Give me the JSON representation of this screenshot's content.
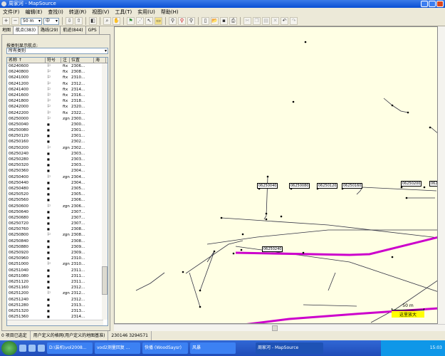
{
  "window": {
    "title": "周家河 - MapSource"
  },
  "menu": [
    "文件(F)",
    "编辑(E)",
    "查找(I)",
    "转送(R)",
    "视图(V)",
    "工具(T)",
    "实用(U)",
    "帮助(H)"
  ],
  "toolbar": {
    "zoom_scale": "50 m",
    "detail": "中"
  },
  "tabs": [
    "地图",
    "航点(383)",
    "路线(29)",
    "航迹(844)",
    "GPS"
  ],
  "waypoints_panel": {
    "category_label": "按类别显示航点:",
    "category_value": "所有类别",
    "columns": [
      "名称 ↑",
      "符号",
      "注",
      "位置",
      "海"
    ],
    "rows": [
      [
        "06240600",
        "flag",
        "ftx",
        "2306..."
      ],
      [
        "06240800",
        "flag",
        "ftx",
        "2308..."
      ],
      [
        "06241000",
        "flag",
        "ftx",
        "2310..."
      ],
      [
        "06241200",
        "flag",
        "ftx",
        "2312..."
      ],
      [
        "06241400",
        "flag",
        "ftx",
        "2314..."
      ],
      [
        "06241600",
        "flag",
        "ftx",
        "2316..."
      ],
      [
        "06241800",
        "flag",
        "ftx",
        "2318..."
      ],
      [
        "06242000",
        "flag",
        "ftx",
        "2320..."
      ],
      [
        "06242200",
        "flag",
        "ftx",
        "2322..."
      ],
      [
        "06250000",
        "flag",
        "zgn",
        "2300..."
      ],
      [
        "06250040",
        "dot",
        "",
        "2300..."
      ],
      [
        "06250080",
        "dot",
        "",
        "2301..."
      ],
      [
        "06250120",
        "dot",
        "",
        "2301..."
      ],
      [
        "06250160",
        "dot",
        "",
        "2302..."
      ],
      [
        "06250200",
        "flag",
        "zgn",
        "2302..."
      ],
      [
        "06250240",
        "dot",
        "",
        "2303..."
      ],
      [
        "06250280",
        "dot",
        "",
        "2303..."
      ],
      [
        "06250320",
        "dot",
        "",
        "2303..."
      ],
      [
        "06250360",
        "dot",
        "",
        "2304..."
      ],
      [
        "06250400",
        "flag",
        "zgn",
        "2304..."
      ],
      [
        "06250440",
        "dot",
        "",
        "2304..."
      ],
      [
        "06250480",
        "dot",
        "",
        "2305..."
      ],
      [
        "06250520",
        "dot",
        "",
        "2305..."
      ],
      [
        "06250560",
        "dot",
        "",
        "2306..."
      ],
      [
        "06250600",
        "flag",
        "zgn",
        "2306..."
      ],
      [
        "06250640",
        "dot",
        "",
        "2307..."
      ],
      [
        "06250680",
        "dot",
        "",
        "2307..."
      ],
      [
        "06250720",
        "dot",
        "",
        "2307..."
      ],
      [
        "06250760",
        "dot",
        "",
        "2308..."
      ],
      [
        "06250800",
        "flag",
        "zgn",
        "2308..."
      ],
      [
        "06250840",
        "dot",
        "",
        "2308..."
      ],
      [
        "06250880",
        "dot",
        "",
        "2309..."
      ],
      [
        "06250920",
        "dot",
        "",
        "2309..."
      ],
      [
        "06250960",
        "dot",
        "",
        "2310..."
      ],
      [
        "06251000",
        "flag",
        "zgn",
        "2310..."
      ],
      [
        "06251040",
        "dot",
        "",
        "2311..."
      ],
      [
        "06251080",
        "dot",
        "",
        "2311..."
      ],
      [
        "06251120",
        "dot",
        "",
        "2311..."
      ],
      [
        "06251160",
        "dot",
        "",
        "2312..."
      ],
      [
        "06251200",
        "flag",
        "zgn",
        "2312..."
      ],
      [
        "06251240",
        "dot",
        "",
        "2312..."
      ],
      [
        "06251280",
        "dot",
        "",
        "2313..."
      ],
      [
        "06251320",
        "dot",
        "",
        "2313..."
      ],
      [
        "06251360",
        "dot",
        "",
        "2314..."
      ],
      [
        "06251400",
        "flag",
        "zgn",
        "2314..."
      ]
    ]
  },
  "map": {
    "waypoint_labels": [
      "06250040",
      "06250080",
      "06250120",
      "06250160",
      "06250200",
      "062"
    ],
    "lower_label": "06250240",
    "scale": "50 m",
    "zoom_hint": "这里放大",
    "track_color": "#cc00cc"
  },
  "status": {
    "selected": "0 项目已选定",
    "grid": "用户定义的格网(用户定义的地图基准)",
    "coords": "230146  3294571"
  },
  "taskbar": {
    "items": [
      "D:\\装机\\vol2008...",
      "vod2测量回复 ...",
      "快播 (WoodSaysr)",
      "风暴"
    ],
    "active": "周家河 - MapSource",
    "clock": "15:03"
  }
}
